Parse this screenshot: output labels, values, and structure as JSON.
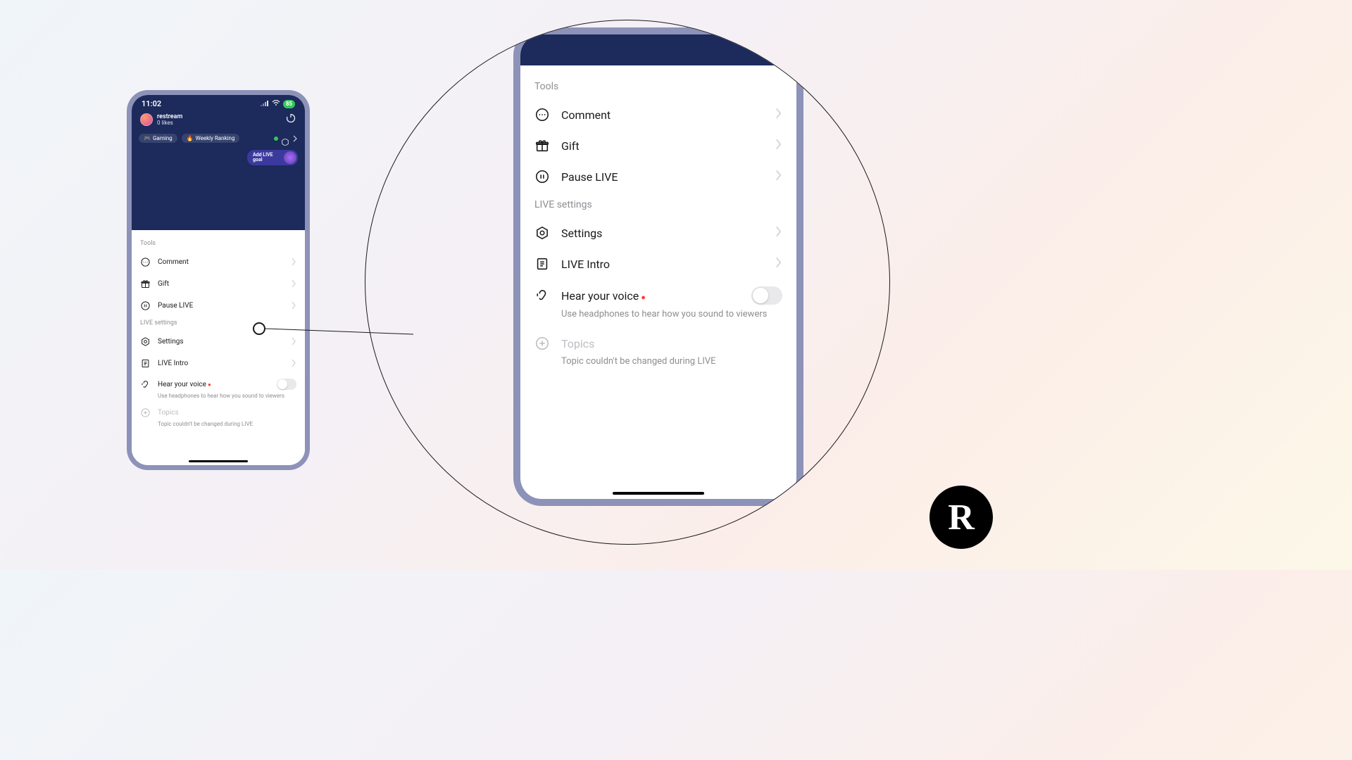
{
  "status": {
    "time": "11:02",
    "battery": "85"
  },
  "profile": {
    "name": "restream",
    "likes": "0 likes"
  },
  "chips": {
    "gaming": "Gaming",
    "ranking": "Weekly Ranking"
  },
  "goal": "Add LIVE goal",
  "sections": {
    "tools": "Tools",
    "live_settings": "LIVE settings"
  },
  "items": {
    "comment": "Comment",
    "gift": "Gift",
    "pause": "Pause LIVE",
    "settings": "Settings",
    "intro": "LIVE Intro",
    "hear": "Hear your voice",
    "hear_sub": "Use headphones to hear how you sound to viewers",
    "topics": "Topics",
    "topics_sub": "Topic couldn't be changed during LIVE"
  },
  "logo": "R"
}
